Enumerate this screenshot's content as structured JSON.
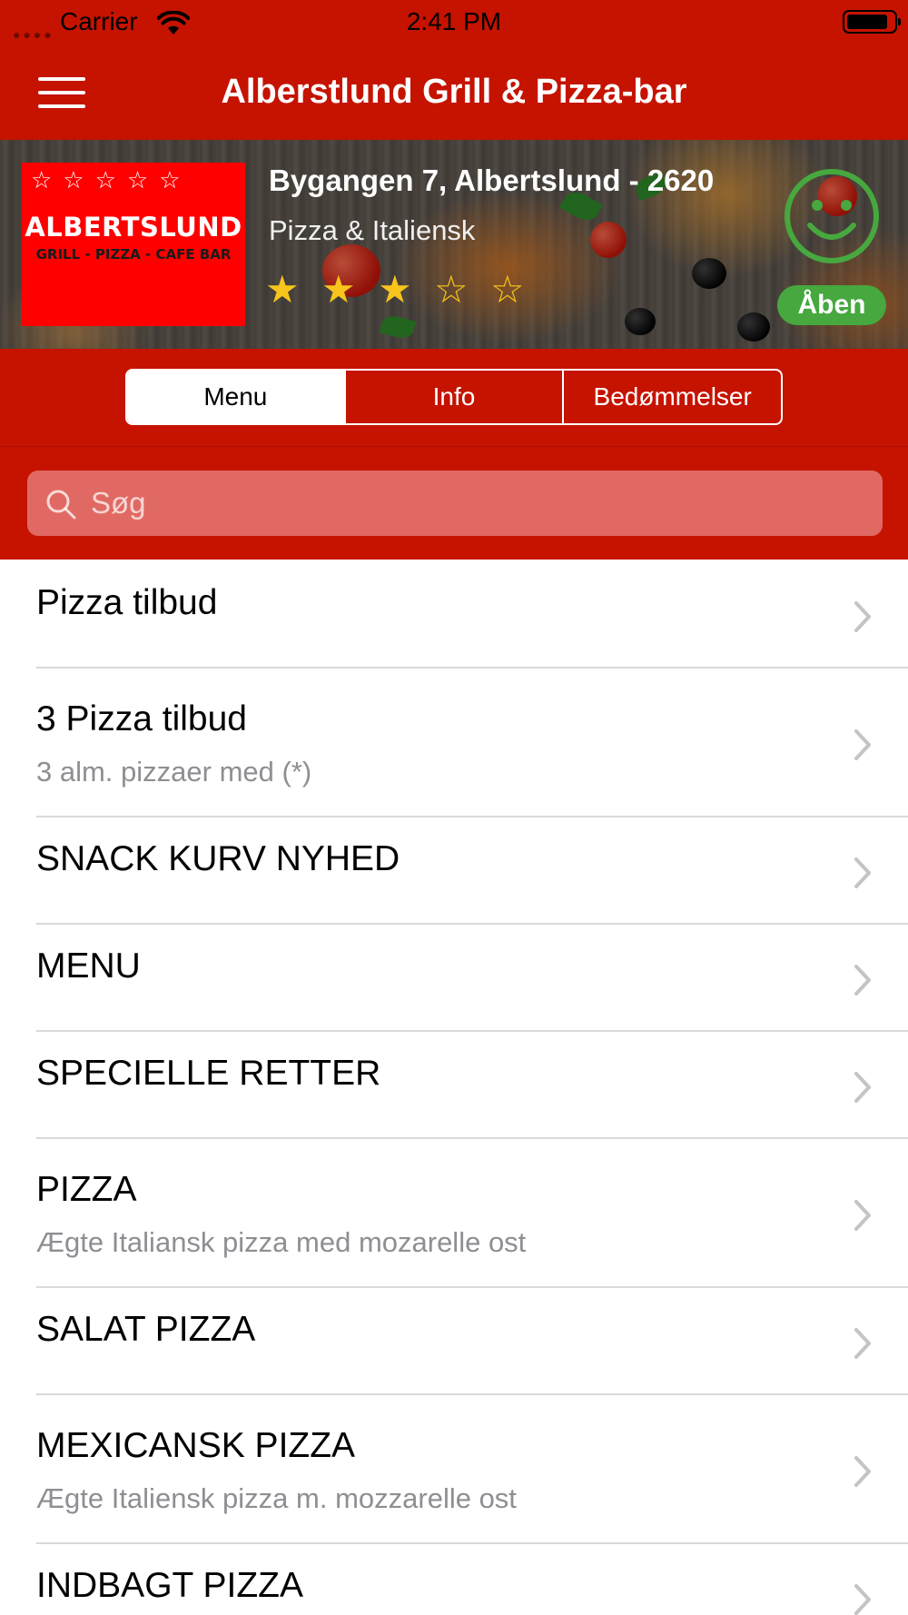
{
  "status_bar": {
    "carrier": "Carrier",
    "time": "2:41 PM"
  },
  "nav": {
    "title": "Alberstlund Grill & Pizza-bar"
  },
  "restaurant": {
    "logo_name": "ALBERTSLUND",
    "logo_sub": "GRILL - PIZZA - CAFE BAR",
    "logo_stars": "☆☆☆☆☆",
    "address": "Bygangen 7, Albertslund - 2620",
    "cuisine": "Pizza & Italiensk",
    "rating": 3.5,
    "rating_max": 5,
    "status": "Åben",
    "status_color": "#46a83e",
    "smiley_color": "#46a83e"
  },
  "tabs": [
    {
      "label": "Menu",
      "active": true
    },
    {
      "label": "Info",
      "active": false
    },
    {
      "label": "Bedømmelser",
      "active": false
    }
  ],
  "search": {
    "placeholder": "Søg"
  },
  "menu_items": [
    {
      "title": "Pizza tilbud",
      "subtitle": ""
    },
    {
      "title": "3 Pizza tilbud",
      "subtitle": "3 alm. pizzaer med (*)"
    },
    {
      "title": "SNACK KURV NYHED",
      "subtitle": ""
    },
    {
      "title": "MENU",
      "subtitle": ""
    },
    {
      "title": "SPECIELLE RETTER",
      "subtitle": ""
    },
    {
      "title": "PIZZA",
      "subtitle": "Ægte Italiansk pizza med mozarelle ost"
    },
    {
      "title": "SALAT PIZZA",
      "subtitle": ""
    },
    {
      "title": "MEXICANSK PIZZA",
      "subtitle": "Ægte Italiensk pizza m. mozzarelle ost"
    },
    {
      "title": "INDBAGT PIZZA",
      "subtitle": ""
    }
  ],
  "colors": {
    "brand_red": "#c51300",
    "search_bg": "#e06a63",
    "star": "#f7c51b"
  },
  "icons": {
    "menu": "hamburger-icon",
    "wifi": "wifi-icon",
    "battery": "battery-icon",
    "search": "search-icon",
    "smiley": "smiley-icon",
    "chevron": "chevron-right-icon"
  }
}
